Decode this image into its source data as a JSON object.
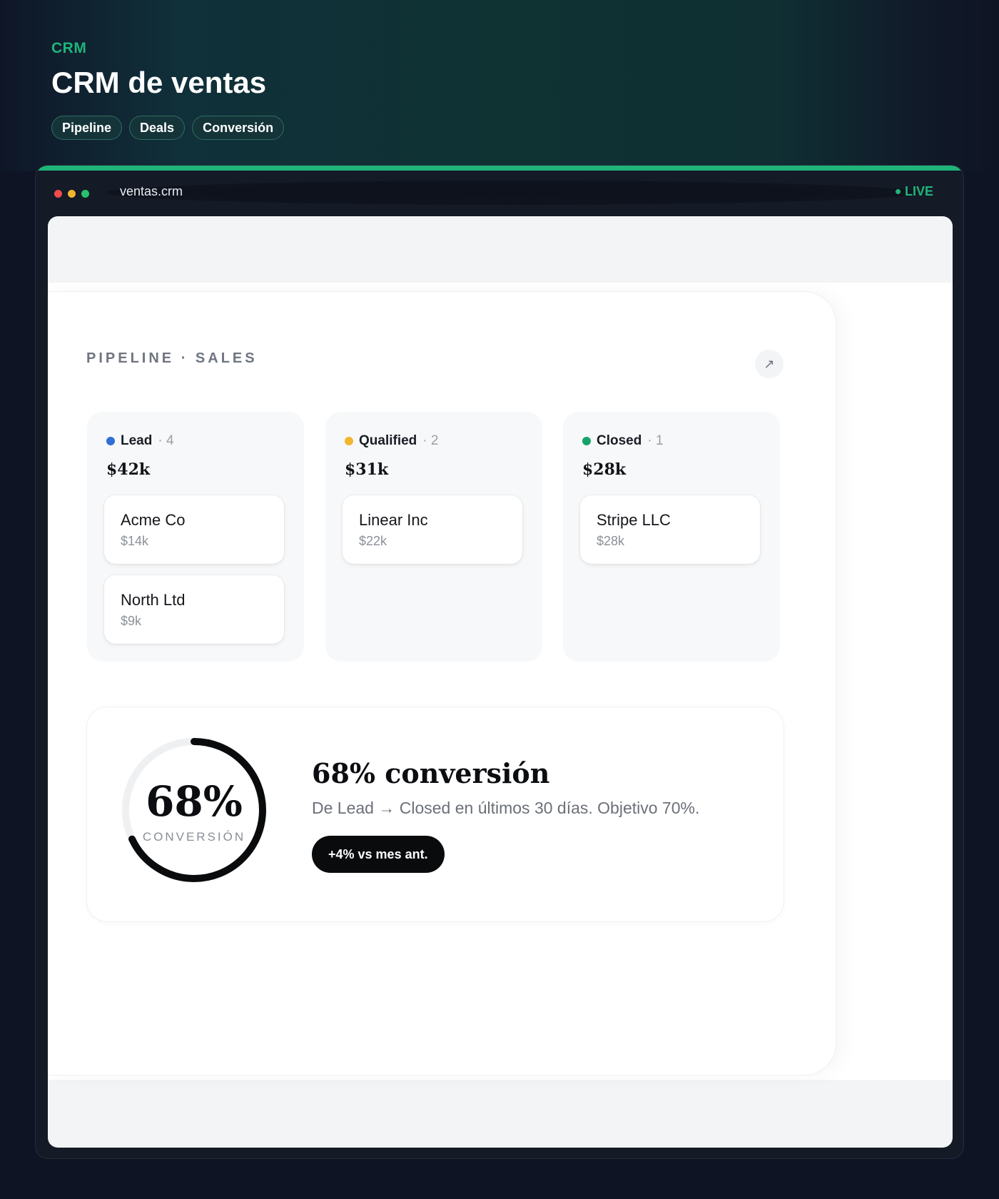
{
  "header": {
    "eyebrow": "CRM",
    "title": "CRM de ventas",
    "chips": [
      "Pipeline",
      "Deals",
      "Conversión"
    ]
  },
  "window": {
    "url": "ventas.crm",
    "status": "LIVE"
  },
  "pipeline": {
    "label": "PIPELINE · SALES",
    "expand_icon": "arrow-up-right-icon",
    "columns": [
      {
        "name": "Lead",
        "count": "· 4",
        "total": "$42k",
        "color": "#2f6fd6",
        "deals": [
          {
            "name": "Acme Co",
            "value": "$14k"
          },
          {
            "name": "North Ltd",
            "value": "$9k"
          }
        ]
      },
      {
        "name": "Qualified",
        "count": "· 2",
        "total": "$31k",
        "color": "#f2b52e",
        "deals": [
          {
            "name": "Linear Inc",
            "value": "$22k"
          }
        ]
      },
      {
        "name": "Closed",
        "count": "· 1",
        "total": "$28k",
        "color": "#16a36b",
        "deals": [
          {
            "name": "Stripe LLC",
            "value": "$28k"
          }
        ]
      }
    ]
  },
  "conversion": {
    "percent": 0.68,
    "value_label": "68%",
    "ring_label": "CONVERSIÓN",
    "title": "68% conversión",
    "subtitle": "De Lead → Closed en últimos 30 días. Objetivo 70%.",
    "badge": "+4% vs mes ant."
  },
  "colors": {
    "accent": "#1fb47a",
    "page_bg": "#0f1424",
    "ring": "#0a0b0d"
  }
}
